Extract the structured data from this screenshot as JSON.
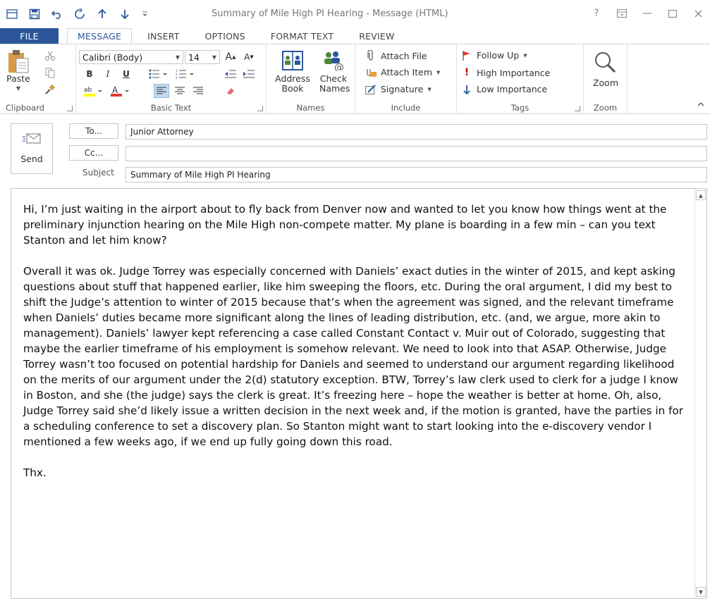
{
  "window": {
    "title": "Summary of Mile High PI Hearing  - Message (HTML)",
    "controls": {
      "help": "?",
      "restore_ribbon": "⊡",
      "minimize": "—",
      "maximize": "☐",
      "close": "✕"
    }
  },
  "tabs": [
    {
      "label": "FILE"
    },
    {
      "label": "MESSAGE"
    },
    {
      "label": "INSERT"
    },
    {
      "label": "OPTIONS"
    },
    {
      "label": "FORMAT TEXT"
    },
    {
      "label": "REVIEW"
    }
  ],
  "ribbon": {
    "clipboard": {
      "label": "Clipboard",
      "paste": "Paste"
    },
    "basic_text": {
      "label": "Basic Text",
      "font": "Calibri (Body)",
      "size": "14",
      "bold": "B",
      "italic": "I",
      "underline": "U",
      "grow": "A",
      "shrink": "A"
    },
    "names": {
      "label": "Names",
      "address_book": "Address Book",
      "check_names": "Check Names"
    },
    "include": {
      "label": "Include",
      "attach_file": "Attach File",
      "attach_item": "Attach Item",
      "signature": "Signature"
    },
    "tags": {
      "label": "Tags",
      "follow_up": "Follow Up",
      "high_importance": "High Importance",
      "low_importance": "Low Importance"
    },
    "zoom": {
      "label": "Zoom",
      "zoom_btn": "Zoom"
    }
  },
  "header": {
    "send": "Send",
    "to_button": "To...",
    "cc_button": "Cc...",
    "subject_label": "Subject",
    "to_value": "Junior Attorney",
    "cc_value": "",
    "subject_value": "Summary of Mile High PI Hearing"
  },
  "message": {
    "paragraphs": [
      "Hi, I’m just waiting in the airport about to fly back from Denver now and wanted to let you know how things went at the preliminary injunction hearing on the Mile High non-compete matter.  My plane is boarding in a few min – can you text Stanton and let him know?",
      "Overall it was ok.  Judge Torrey was especially concerned with Daniels’ exact duties in the winter of 2015, and kept asking questions about stuff that happened earlier, like him sweeping the floors, etc.  During the oral argument, I did my best to shift the Judge’s attention to winter of 2015 because that’s when the agreement was signed, and the relevant timeframe when Daniels’ duties became more significant along the lines of leading distribution, etc. (and, we argue, more akin to management).  Daniels’ lawyer kept referencing a case called Constant Contact v. Muir out of Colorado, suggesting that maybe the earlier timeframe of his employment is somehow relevant.  We need to look into that ASAP.  Otherwise, Judge Torrey wasn’t too focused on potential hardship for Daniels and seemed to understand our argument regarding likelihood on the merits of our argument under the 2(d) statutory exception.  BTW, Torrey’s law clerk used to clerk for a judge I know in Boston, and she (the judge) says the clerk is great.  It’s freezing here – hope the weather is better at home.  Oh, also, Judge Torrey said she’d likely issue a written decision in the next week and, if the motion is granted, have the parties in for a scheduling conference to set a discovery plan.  So Stanton might want to start looking into the e-discovery vendor I mentioned a few weeks ago, if we end up fully going down this road.",
      "Thx."
    ]
  },
  "colors": {
    "accent": "#2b579a",
    "follow_up_flag": "#e03c31",
    "high_importance": "#c00000",
    "low_importance": "#2b579a"
  }
}
